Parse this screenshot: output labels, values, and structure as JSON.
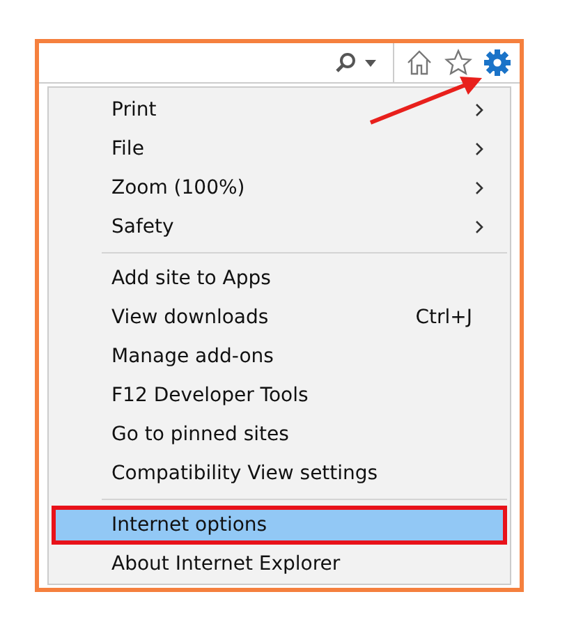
{
  "menu": {
    "groups": [
      [
        {
          "label": "Print",
          "submenu": true,
          "selected": false,
          "annotated": false
        },
        {
          "label": "File",
          "submenu": true,
          "selected": false,
          "annotated": false
        },
        {
          "label": "Zoom (100%)",
          "submenu": true,
          "selected": false,
          "annotated": false
        },
        {
          "label": "Safety",
          "submenu": true,
          "selected": false,
          "annotated": false
        }
      ],
      [
        {
          "label": "Add site to Apps",
          "submenu": false,
          "selected": false,
          "annotated": false
        },
        {
          "label": "View downloads",
          "shortcut": "Ctrl+J",
          "submenu": false,
          "selected": false,
          "annotated": false
        },
        {
          "label": "Manage add-ons",
          "submenu": false,
          "selected": false,
          "annotated": false
        },
        {
          "label": "F12 Developer Tools",
          "submenu": false,
          "selected": false,
          "annotated": false
        },
        {
          "label": "Go to pinned sites",
          "submenu": false,
          "selected": false,
          "annotated": false
        },
        {
          "label": "Compatibility View settings",
          "submenu": false,
          "selected": false,
          "annotated": false
        }
      ],
      [
        {
          "label": "Internet options",
          "submenu": false,
          "selected": true,
          "annotated": true
        },
        {
          "label": "About Internet Explorer",
          "submenu": false,
          "selected": false,
          "annotated": false
        }
      ]
    ]
  }
}
